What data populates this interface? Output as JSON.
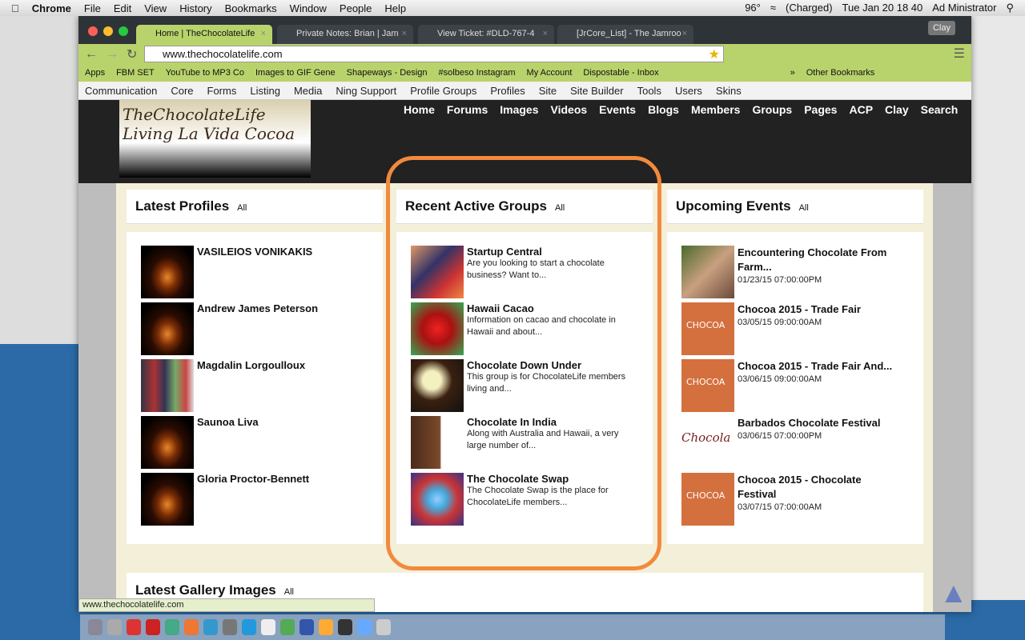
{
  "menubar": {
    "app": "Chrome",
    "items": [
      "File",
      "Edit",
      "View",
      "History",
      "Bookmarks",
      "Window",
      "People",
      "Help"
    ],
    "temp": "96°",
    "battery": "(Charged)",
    "datetime": "Tue Jan 20  18 40",
    "user": "Ad Ministrator"
  },
  "tabs": [
    {
      "label": "Home | TheChocolateLife"
    },
    {
      "label": "Private Notes: Brian | Jam"
    },
    {
      "label": "View Ticket: #DLD-767-4"
    },
    {
      "label": "[JrCore_List] - The Jamroo"
    }
  ],
  "profile_button": "Clay",
  "url": "www.thechocolatelife.com",
  "bookmarks": [
    "Apps",
    "FBM SET",
    "YouTube to MP3 Co",
    "Images to GIF Gene",
    "Shapeways - Design",
    "#solbeso Instagram",
    "My Account",
    "Dispostable - Inbox",
    "»",
    "Other Bookmarks"
  ],
  "ext_menu": [
    "Communication",
    "Core",
    "Forms",
    "Listing",
    "Media",
    "Ning Support",
    "Profile Groups",
    "Profiles",
    "Site",
    "Site Builder",
    "Tools",
    "Users",
    "Skins"
  ],
  "site": {
    "logo_text": "TheChocolateLife Living La Vida Cocoa",
    "nav": [
      "Home",
      "Forums",
      "Images",
      "Videos",
      "Events",
      "Blogs",
      "Members",
      "Groups",
      "Pages",
      "ACP",
      "Clay",
      "Search"
    ]
  },
  "profiles": {
    "title": "Latest Profiles",
    "all": "All",
    "items": [
      {
        "name": "VASILEIOS VONIKAKIS"
      },
      {
        "name": "Andrew James Peterson"
      },
      {
        "name": "Magdalin Lorgoulloux"
      },
      {
        "name": "Saunoa Liva"
      },
      {
        "name": "Gloria Proctor-Bennett"
      }
    ]
  },
  "groups": {
    "title": "Recent Active Groups",
    "all": "All",
    "items": [
      {
        "name": "Startup Central",
        "desc": "Are you looking to start a chocolate business? Want to..."
      },
      {
        "name": "Hawaii Cacao",
        "desc": "Information on cacao and chocolate in Hawaii and about..."
      },
      {
        "name": "Chocolate Down Under",
        "desc": "This group is for ChocolateLife members living and..."
      },
      {
        "name": "Chocolate In India",
        "desc": "Along with Australia and Hawaii, a very large number of..."
      },
      {
        "name": "The Chocolate Swap",
        "desc": "The Chocolate Swap is the place for ChocolateLife members..."
      }
    ]
  },
  "events": {
    "title": "Upcoming Events",
    "all": "All",
    "items": [
      {
        "name": "Encountering Chocolate From Farm...",
        "date": "01/23/15 07:00:00PM"
      },
      {
        "name": "Chocoa 2015 - Trade Fair",
        "date": "03/05/15 09:00:00AM"
      },
      {
        "name": "Chocoa 2015 - Trade Fair And...",
        "date": "03/06/15 09:00:00AM"
      },
      {
        "name": "Barbados Chocolate Festival",
        "date": "03/06/15 07:00:00PM"
      },
      {
        "name": "Chocoa 2015 - Chocolate Festival",
        "date": "03/07/15 07:00:00AM"
      }
    ]
  },
  "gallery": {
    "title": "Latest Gallery Images",
    "all": "All"
  },
  "status_url": "www.thechocolatelife.com",
  "colors": {
    "highlight": "#f28a3c",
    "chrome_theme": "#b9d36c"
  }
}
